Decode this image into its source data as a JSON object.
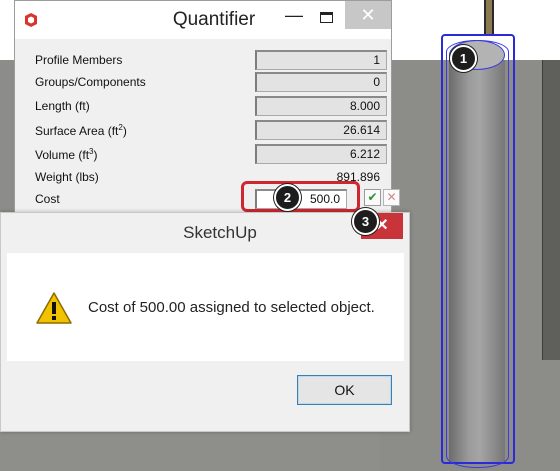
{
  "quantifier": {
    "title": "Quantifier",
    "rows": [
      {
        "label": "Profile Members",
        "value": "1"
      },
      {
        "label": "Groups/Components",
        "value": "0"
      },
      {
        "label": "Length (ft)",
        "value": "8.000"
      },
      {
        "label_pre": "Surface Area (ft",
        "label_sup": "2",
        "label_post": ")",
        "value": "26.614"
      },
      {
        "label_pre": "Volume (ft",
        "label_sup": "3",
        "label_post": ")",
        "value": "6.212"
      },
      {
        "label": "Weight (lbs)",
        "value": "891.896"
      }
    ],
    "cost": {
      "label": "Cost",
      "value": "500.0"
    }
  },
  "dialog": {
    "title": "SketchUp",
    "message": "Cost of 500.00 assigned to selected object.",
    "ok_label": "OK"
  },
  "callouts": [
    "1",
    "2",
    "3"
  ],
  "colors": {
    "selection": "#2a2ad8",
    "callout_border": "#d0262f",
    "close_red": "#c8343a"
  },
  "icons": [
    "sketchup-logo-icon",
    "minimize-icon",
    "maximize-icon",
    "close-icon",
    "checkmark-icon",
    "cancel-x-icon",
    "warning-icon"
  ]
}
